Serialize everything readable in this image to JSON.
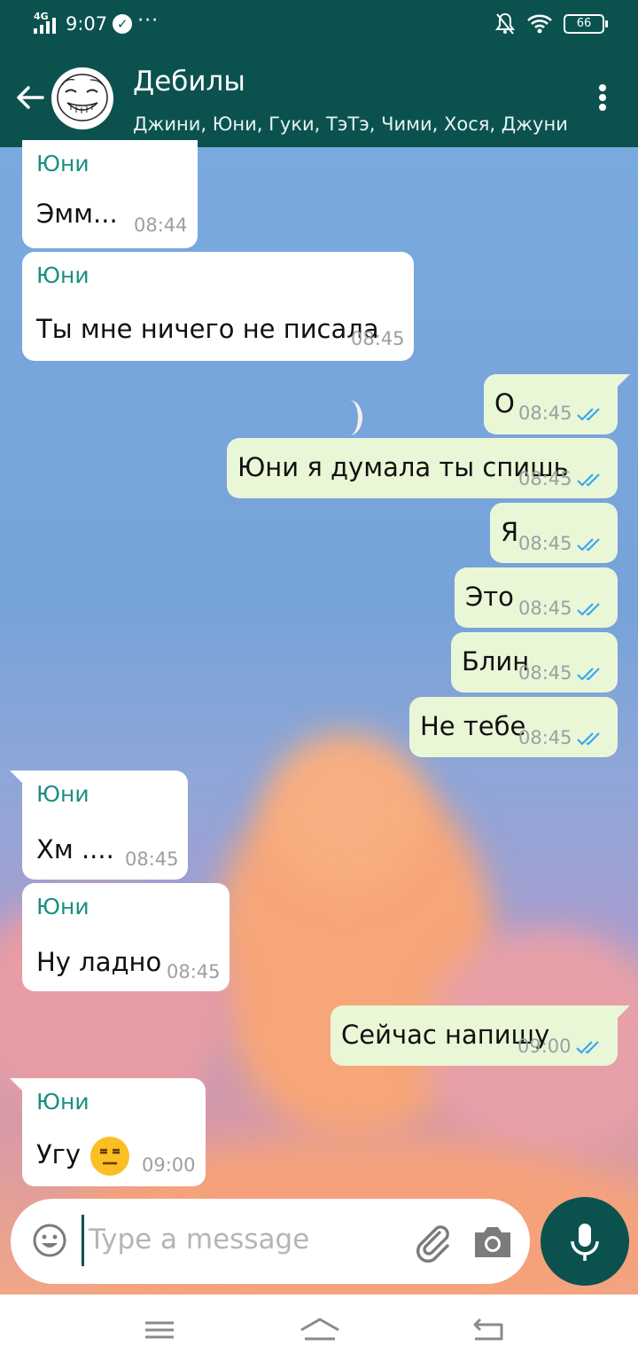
{
  "status_bar": {
    "network": "4G",
    "time": "9:07",
    "battery": "66"
  },
  "header": {
    "title": "Дебилы",
    "subtitle": "Джини, Юни, Гуки, ТэТэ, Чими, Хося, Джуни"
  },
  "messages": [
    {
      "direction": "in",
      "sender": "Юни",
      "text": "Эмм...",
      "time": "08:44"
    },
    {
      "direction": "in",
      "sender": "Юни",
      "text": "Ты мне ничего не писала",
      "time": "08:45"
    },
    {
      "direction": "out",
      "text": "О",
      "time": "08:45"
    },
    {
      "direction": "out",
      "text": "Юни я думала ты спишь",
      "time": "08:45"
    },
    {
      "direction": "out",
      "text": "Я",
      "time": "08:45"
    },
    {
      "direction": "out",
      "text": "Это",
      "time": "08:45"
    },
    {
      "direction": "out",
      "text": "Блин",
      "time": "08:45"
    },
    {
      "direction": "out",
      "text": "Не тебе",
      "time": "08:45"
    },
    {
      "direction": "in",
      "sender": "Юни",
      "text": "Хм ....",
      "time": "08:45"
    },
    {
      "direction": "in",
      "sender": "Юни",
      "text": "Ну ладно",
      "time": "08:45"
    },
    {
      "direction": "out",
      "text": "Сейчас напишу",
      "time": "09:00"
    },
    {
      "direction": "in",
      "sender": "Юни",
      "text": "Угу",
      "emoji": "expressionless-face",
      "time": "09:00"
    }
  ],
  "composer": {
    "placeholder": "Type a message"
  },
  "colors": {
    "primary": "#0b524f",
    "outgoing_bubble": "#eaf7d7",
    "sender_name": "#1a8f80",
    "tick": "#3aa7ee"
  }
}
